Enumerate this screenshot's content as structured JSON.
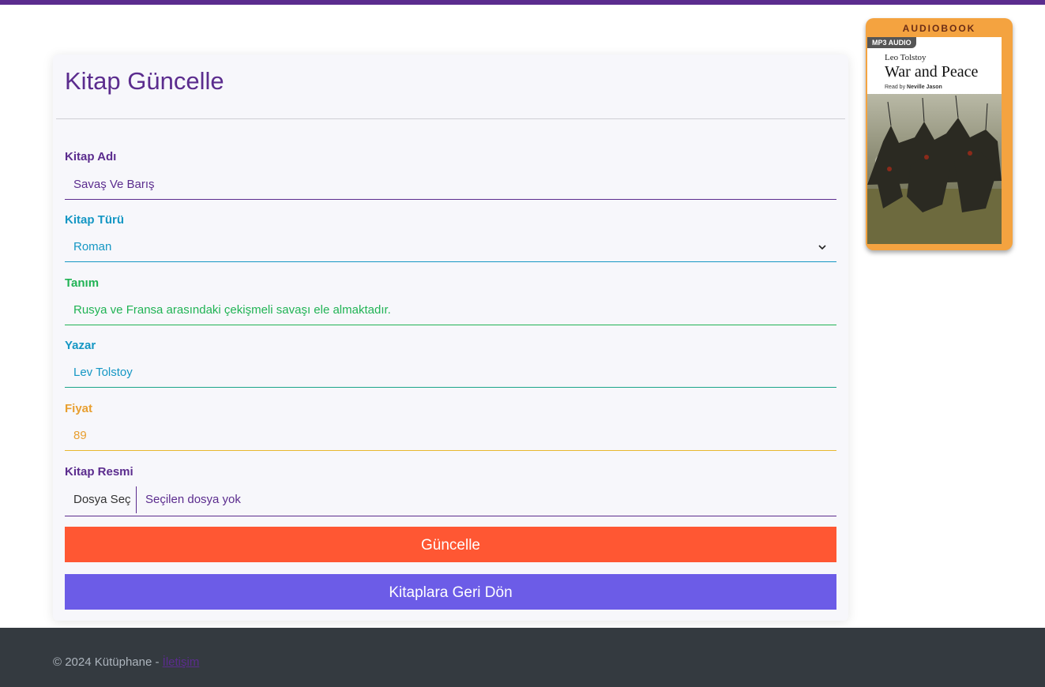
{
  "form": {
    "title": "Kitap Güncelle",
    "fields": [
      {
        "label": "Kitap Adı",
        "value": "Savaş Ve Barış",
        "color": "#5b2c8e"
      },
      {
        "label": "Kitap Türü",
        "value": "Roman",
        "color": "#1597c4"
      },
      {
        "label": "Tanım",
        "value": "Rusya ve Fransa arasındaki çekişmeli savaşı ele almaktadır.",
        "color": "#20b354"
      },
      {
        "label": "Yazar",
        "value": "Lev Tolstoy",
        "color": "#1597c4"
      },
      {
        "label": "Fiyat",
        "value": "89",
        "color": "#e89f30"
      }
    ],
    "image_field": {
      "label": "Kitap Resmi",
      "button_label": "Dosya Seç",
      "status": "Seçilen dosya yok"
    },
    "update_button": "Güncelle",
    "back_button": "Kitaplara Geri Dön"
  },
  "cover": {
    "badge_top": "AUDIOBOOK",
    "badge_format": "MP3 AUDIO",
    "author": "Leo Tolstoy",
    "title": "War and Peace",
    "reader_prefix": "Read by",
    "reader_name": "Neville Jason"
  },
  "footer": {
    "text": "© 2024 Kütüphane - ",
    "link": "İletişim"
  },
  "colors": {
    "brand": "#5b2c8e",
    "update": "#ff5733",
    "back": "#6c5ce7",
    "footer_bg": "#343a40"
  }
}
